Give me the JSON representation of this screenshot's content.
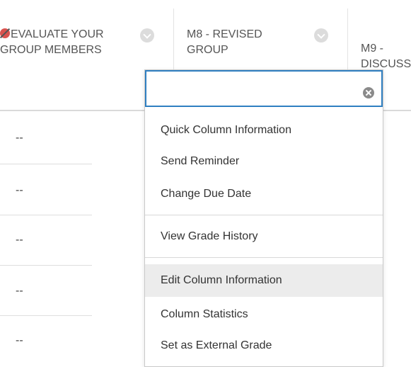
{
  "columns": [
    {
      "label": "EVALUATE YOUR GROUP MEMBERS",
      "icon": "no-entry-icon"
    },
    {
      "label": "M8 - REVISED GROUP"
    },
    {
      "label": "M9 - DISCUSS"
    }
  ],
  "rows": [
    {
      "value": "--"
    },
    {
      "value": "--"
    },
    {
      "value": "--"
    },
    {
      "value": "--"
    },
    {
      "value": "--"
    }
  ],
  "menu": {
    "search_value": "",
    "search_placeholder": "",
    "items": [
      {
        "label": "Quick Column Information"
      },
      {
        "label": "Send Reminder"
      },
      {
        "label": "Change Due Date"
      },
      {
        "label": "View Grade History"
      },
      {
        "label": "Edit Column Information"
      },
      {
        "label": "Column Statistics"
      },
      {
        "label": "Set as External Grade"
      }
    ]
  },
  "colors": {
    "accent": "#2f7fc1",
    "hover": "#ececec",
    "icon_red": "#d9534f"
  }
}
